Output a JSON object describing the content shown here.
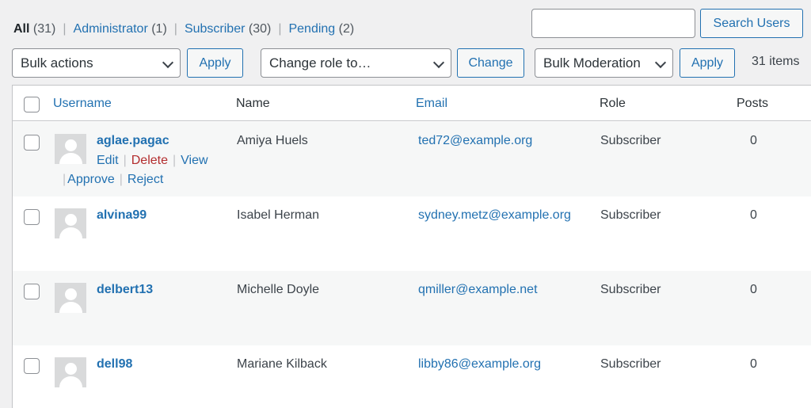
{
  "filters": {
    "all": {
      "label": "All",
      "count": "(31)"
    },
    "administrator": {
      "label": "Administrator",
      "count": "(1)"
    },
    "subscriber": {
      "label": "Subscriber",
      "count": "(30)"
    },
    "pending": {
      "label": "Pending",
      "count": "(2)"
    },
    "separator": "|"
  },
  "search": {
    "value": "",
    "button_label": "Search Users"
  },
  "toolbar": {
    "bulk_actions": "Bulk actions",
    "apply_label": "Apply",
    "change_role": "Change role to…",
    "change_label": "Change",
    "bulk_moderation": "Bulk Moderation",
    "apply2_label": "Apply",
    "items_count": "31 items"
  },
  "columns": {
    "username": "Username",
    "name": "Name",
    "email": "Email",
    "role": "Role",
    "posts": "Posts"
  },
  "row_actions": {
    "edit": "Edit",
    "delete": "Delete",
    "view": "View",
    "approve": "Approve",
    "reject": "Reject",
    "separator": "|"
  },
  "users": [
    {
      "username": "aglae.pagac",
      "name": "Amiya Huels",
      "email": "ted72@example.org",
      "role": "Subscriber",
      "posts": "0"
    },
    {
      "username": "alvina99",
      "name": "Isabel Herman",
      "email": "sydney.metz@example.org",
      "role": "Subscriber",
      "posts": "0"
    },
    {
      "username": "delbert13",
      "name": "Michelle Doyle",
      "email": "qmiller@example.net",
      "role": "Subscriber",
      "posts": "0"
    },
    {
      "username": "dell98",
      "name": "Mariane Kilback",
      "email": "libby86@example.org",
      "role": "Subscriber",
      "posts": "0"
    }
  ]
}
